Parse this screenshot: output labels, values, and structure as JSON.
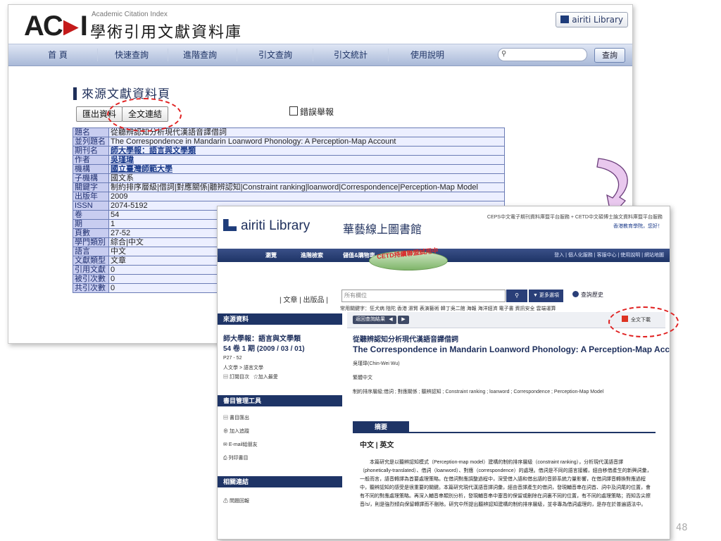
{
  "aci": {
    "logo": "ACI",
    "subtitle_en": "Academic Citation Index",
    "subtitle_zh": "學術引用文獻資料庫",
    "brand": "airiti Library",
    "nav": [
      "首 頁",
      "快速查詢",
      "進階查詢",
      "引文查詢",
      "引文統計",
      "使用說明"
    ],
    "search_button": "查詢",
    "page_heading": "來源文獻資料頁",
    "export_button": "匯出資料",
    "fulltext_button": "全文連結",
    "error_report": "錯誤舉報",
    "rows": [
      {
        "label": "題名",
        "value": "從聽辨認知分析現代漢語音譯借詞"
      },
      {
        "label": "並列題名",
        "value": "The Correspondence in Mandarin Loanword Phonology: A Perception-Map Account"
      },
      {
        "label": "期刊名",
        "value": "師大學報：語言與文學類",
        "link": true
      },
      {
        "label": "作者",
        "value": "吳瑾瑋",
        "link": true
      },
      {
        "label": "機構",
        "value": "國立臺灣師範大學",
        "link": true
      },
      {
        "label": "子機構",
        "value": "國文系"
      },
      {
        "label": "關鍵字",
        "value": "制約排序層級|借詞|對應關係|聽辨認知|Constraint ranking|loanword|Correspondence|Perception-Map Model"
      },
      {
        "label": "出版年",
        "value": "2009"
      },
      {
        "label": "ISSN",
        "value": "2074-5192"
      },
      {
        "label": "卷",
        "value": "54"
      },
      {
        "label": "期",
        "value": "1"
      },
      {
        "label": "頁數",
        "value": "27-52"
      },
      {
        "label": "學門類別",
        "value": "綜合|中文"
      },
      {
        "label": "語言",
        "value": "中文"
      },
      {
        "label": "文獻類型",
        "value": "文章"
      },
      {
        "label": "引用文獻",
        "value": "0"
      },
      {
        "label": "被引次數",
        "value": "0"
      },
      {
        "label": "共引次數",
        "value": "0"
      }
    ]
  },
  "airiti": {
    "logo": "airiti Library",
    "logo_zh": "華藝線上圖書館",
    "top_links": "CEPS中文電子期刊資料庫暨平台服務 + CETD中文碩博士論文資料庫暨平台服務",
    "greeting": "香港教育學院，您好！",
    "nav": [
      "瀏覽",
      "進階檢索",
      "儲值&購物車"
    ],
    "nav_right": "登入 | 個人化服務 | 客服中心 | 使用說明 | 網站地圖",
    "stamp": "CETD持續聯盟試用中",
    "search_tabs": "| 文章 | 出版品 |",
    "search_placeholder": "所有欄位",
    "more_options": "▼ 更多選項",
    "search_history": "查詢歷史",
    "keywords": "常用關鍵字：狂犬病  陰陀  香港  濕腎  表演藝術  韓丁吳二館  海報  海洋經濟  電子書  資訊安全  雲端運算",
    "side_source_h": "來源資料",
    "journal_name_1": "師大學報：語言與文學類",
    "journal_name_2": "54 卷 1 期 (2009 / 03 / 01)",
    "pages": "P27 - 52",
    "category": "人文學 > 語言文學",
    "subscribe": "訂閱目次",
    "add_fav": "加入最愛",
    "side_tools_h": "書目管理工具",
    "tool_export": "書目匯出",
    "tool_track": "加入追蹤",
    "tool_email": "E-mail給朋友",
    "tool_print": "列印書目",
    "side_links_h": "相關連結",
    "report": "問題回報",
    "back_btn": "返回查詢結果",
    "prev_btn": "◀",
    "next_btn": "▶",
    "fulltext_download": "全文下載",
    "title_zh": "從聽辨認知分析現代漢語音譯借詞",
    "title_en": "The Correspondence in Mandarin Loanword Phonology: A Perception-Map Account",
    "author": "吳瑾瑋(Chin-Wei Wu)",
    "language": "繁體中文",
    "keywords_line": "制約排序層級;借詞 ; 對應關係 ; 聽辨認知 ; Constraint ranking ; loanword ; Correspondence ; Perception-Map Model",
    "abstract_tab": "摘要",
    "lang_switch": "中文 | 英文",
    "abstract": "本篇研究是以聽辨認知模式（Perception-map model）建構的制約排序層級（constraint ranking），分析現代漢語音譯（phonetically-translated）、借詞（loanword）、對應（correspondence）的處理。借詞是不同的語言接觸，經由移借產生的新興詞彙，一般而言，語音轉譯為首要處理策略。在借詞對應調整過程中，深受借入語和借出語的音節系統力量影響，在借詞譯音轉換對應過程中，聽辨認知的感受是很重要的關鍵。本篇研究現代漢語音譯詞彙，經由音譯產生的借詞，發現輔音串在詞首、詞中及詞尾的位置，會有不同的對應處理策略。再深入輔音串類別分析，發現輔音串中塞音的保留或刪除在詞裏不同的位置，有不同的處理策略；而知舌尖擦音/s/，則是強烈傾向保留轉譯而不刪除。研究中所提出聽辨認知建構的制約排序層級，並非專為借詞處理的，是存在於普遍語法中。"
  },
  "page_number": "48",
  "colors": {
    "accent_red": "#e02020",
    "aci_nav": "#a9b9d8",
    "airiti_navy": "#1e3466"
  }
}
